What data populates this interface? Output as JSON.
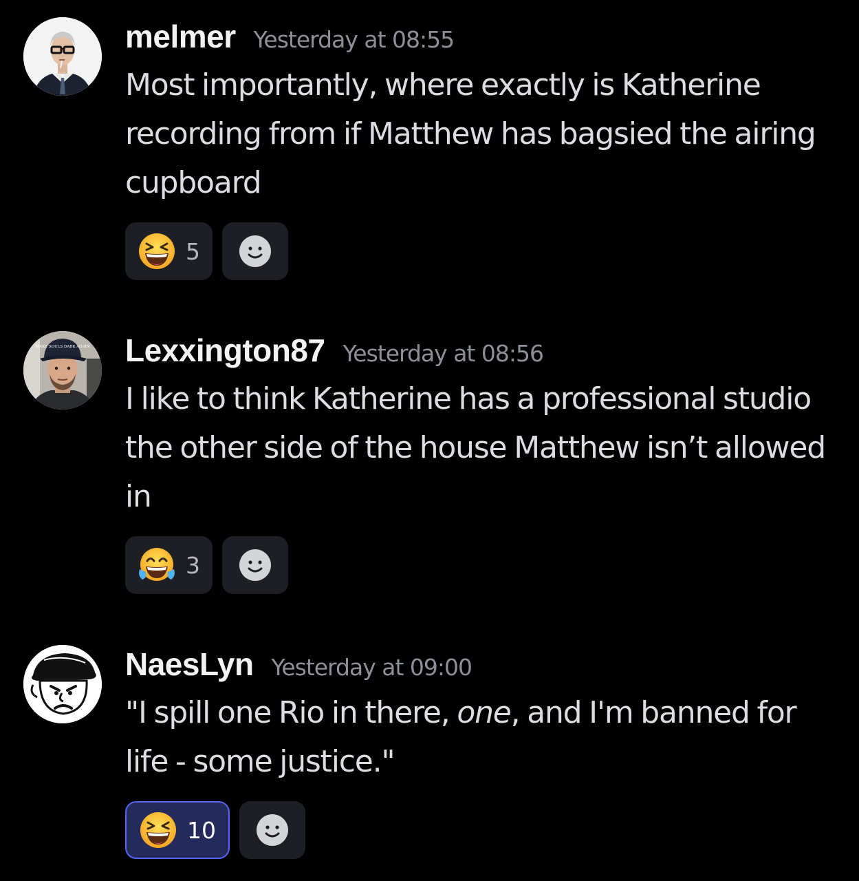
{
  "messages": [
    {
      "username": "melmer",
      "timestamp": "Yesterday at 08:55",
      "avatar_icon": "man-in-suit-glasses-avatar",
      "text": "Most importantly, where exactly is Katherine recording from if Matthew has bagsied the airing cupboard",
      "reactions": [
        {
          "emoji": "laughing-face-emoji",
          "count": "5",
          "active": false
        }
      ]
    },
    {
      "username": "Lexxington87",
      "timestamp": "Yesterday at 08:56",
      "avatar_icon": "man-in-cap-avatar",
      "avatar_cap_text": "MAKE SOULS DARK AGAIN",
      "text": "I like to think Katherine has a professional studio the other side of the house Matthew isn’t allowed in",
      "reactions": [
        {
          "emoji": "tears-of-joy-emoji",
          "count": "3",
          "active": false
        }
      ]
    },
    {
      "username": "NaesLyn",
      "timestamp": "Yesterday at 09:00",
      "avatar_icon": "cartoon-angry-boy-avatar",
      "text_before": "\"I spill one Rio in there, ",
      "text_em": "one",
      "text_after": ", and I'm banned for life - some justice.\"",
      "reactions": [
        {
          "emoji": "laughing-face-emoji",
          "count": "10",
          "active": true
        }
      ]
    }
  ],
  "colors": {
    "background": "#000000",
    "reaction_bg": "#1e1f24",
    "reaction_active_bg": "#252a5c",
    "reaction_active_border": "#5865f2",
    "username": "#f2f3f5",
    "timestamp": "#8e9098"
  }
}
